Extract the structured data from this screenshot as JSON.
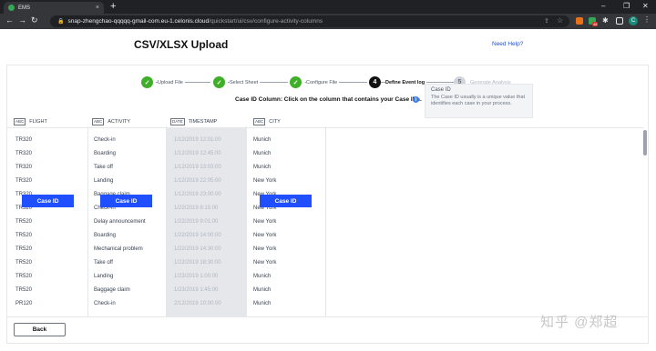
{
  "browser": {
    "tab_title": "EMS",
    "tab_close": "×",
    "new_tab": "+",
    "url_host": "snap-zhengchao-qqqqq-gmail-com.eu-1.celonis.cloud",
    "url_path": "/quickstart/ui/csv/configure-activity-columns",
    "controls": {
      "minimize": "–",
      "maximize": "❐",
      "close": "✕"
    },
    "nav": {
      "back": "←",
      "forward": "→",
      "reload": "↻"
    },
    "profile_initial": "C",
    "badge_count": "46"
  },
  "header": {
    "title": "CSV/XLSX Upload",
    "help_link": "Need Help?"
  },
  "stepper": {
    "steps": [
      {
        "label": "Upload File",
        "state": "done",
        "mark": "✓"
      },
      {
        "label": "Select Sheet",
        "state": "done",
        "mark": "✓"
      },
      {
        "label": "Configure File",
        "state": "done",
        "mark": "✓"
      },
      {
        "label": "Define Event log",
        "state": "active",
        "mark": "4"
      },
      {
        "label": "Generate Analysis",
        "state": "future",
        "mark": "5"
      }
    ]
  },
  "instruction": "Case ID Column: Click on the column that contains your Case IDs.",
  "info_mark": "i",
  "tooltip": {
    "title": "Case ID",
    "body": "The Case ID usually is a unique value that identifies each case in your process."
  },
  "table": {
    "columns": [
      {
        "type": "ABC",
        "name": "FLIGHT"
      },
      {
        "type": "ABC",
        "name": "ACTIVITY"
      },
      {
        "type": "DATE",
        "name": "TIMESTAMP"
      },
      {
        "type": "ABC",
        "name": "CITY"
      }
    ],
    "rows": [
      [
        "TR320",
        "Check-in",
        "1/12/2019 12:01:00",
        "Munich"
      ],
      [
        "TR320",
        "Boarding",
        "1/12/2019 12:45:00",
        "Munich"
      ],
      [
        "TR320",
        "Take off",
        "1/12/2019 13:03:00",
        "Munich"
      ],
      [
        "TR320",
        "Landing",
        "1/12/2019 22:05:00",
        "New York"
      ],
      [
        "TR320",
        "Baggage claim",
        "1/12/2019 23:00:00",
        "New York"
      ],
      [
        "TR520",
        "Check-in",
        "1/22/2019 8:15:00",
        "New York"
      ],
      [
        "TR520",
        "Delay announcement",
        "1/22/2019 9:01:00",
        "New York"
      ],
      [
        "TR520",
        "Boarding",
        "1/22/2019 14:00:00",
        "New York"
      ],
      [
        "TR520",
        "Mechanical problem",
        "1/22/2019 14:30:00",
        "New York"
      ],
      [
        "TR520",
        "Take off",
        "1/22/2019 18:30:00",
        "New York"
      ],
      [
        "TR520",
        "Landing",
        "1/23/2019 1:00:00",
        "Munich"
      ],
      [
        "TR520",
        "Baggage claim",
        "1/23/2019 1:45:00",
        "Munich"
      ],
      [
        "PR120",
        "Check-in",
        "2/12/2019 10:00:00",
        "Munich"
      ]
    ],
    "case_id_label": "Case ID"
  },
  "footer": {
    "back_label": "Back"
  },
  "watermark": "知乎 @郑超"
}
